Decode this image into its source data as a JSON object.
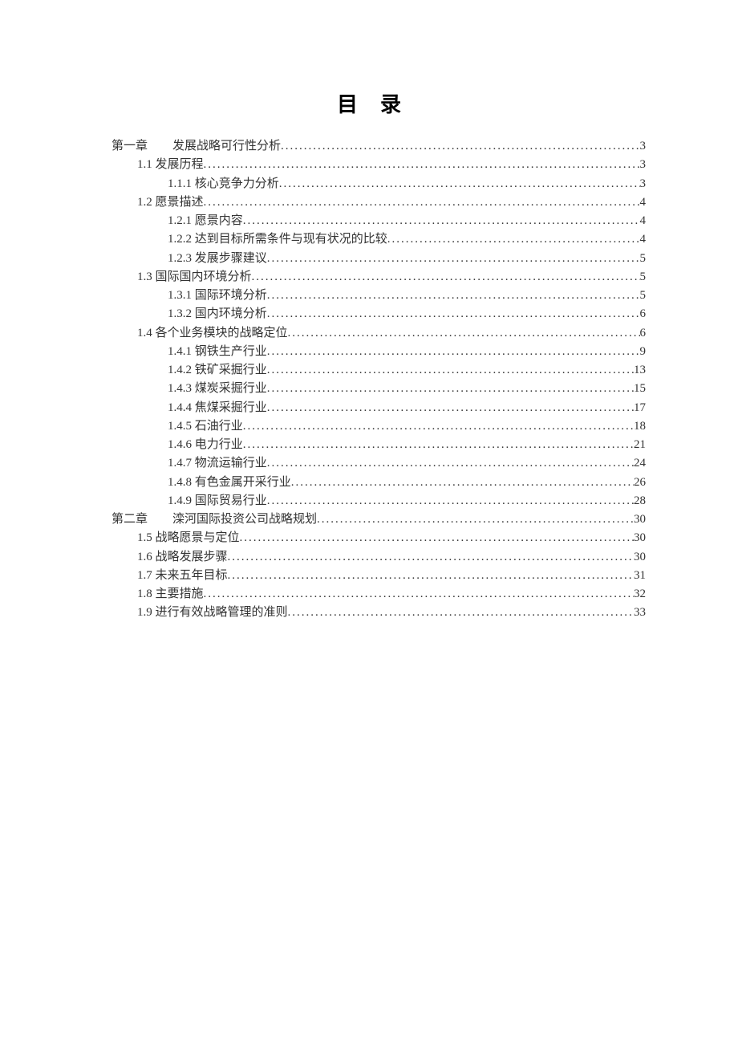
{
  "title": "目录",
  "toc": [
    {
      "level": "chapter",
      "num": "第一章",
      "label": "发展战略可行性分析",
      "page": "3"
    },
    {
      "level": "section",
      "num": "1.1",
      "label": "发展历程",
      "page": "3"
    },
    {
      "level": "sub",
      "num": "1.1.1",
      "label": "核心竞争力分析",
      "page": "3"
    },
    {
      "level": "section",
      "num": "1.2",
      "label": "愿景描述",
      "page": "4"
    },
    {
      "level": "sub",
      "num": "1.2.1",
      "label": "愿景内容",
      "page": "4"
    },
    {
      "level": "sub",
      "num": "1.2.2",
      "label": "达到目标所需条件与现有状况的比较",
      "page": "4"
    },
    {
      "level": "sub",
      "num": "1.2.3",
      "label": "发展步骤建议",
      "page": "5"
    },
    {
      "level": "section",
      "num": "1.3",
      "label": "国际国内环境分析",
      "page": "5"
    },
    {
      "level": "sub",
      "num": "1.3.1",
      "label": "国际环境分析",
      "page": "5"
    },
    {
      "level": "sub",
      "num": "1.3.2",
      "label": "国内环境分析",
      "page": "6"
    },
    {
      "level": "section",
      "num": "1.4",
      "label": "各个业务模块的战略定位",
      "page": "6"
    },
    {
      "level": "sub",
      "num": "1.4.1",
      "label": "钢铁生产行业",
      "page": "9"
    },
    {
      "level": "sub",
      "num": "1.4.2",
      "label": "铁矿采掘行业",
      "page": "13"
    },
    {
      "level": "sub",
      "num": "1.4.3",
      "label": "煤炭采掘行业",
      "page": "15"
    },
    {
      "level": "sub",
      "num": "1.4.4",
      "label": "焦煤采掘行业",
      "page": "17"
    },
    {
      "level": "sub",
      "num": "1.4.5",
      "label": "石油行业",
      "page": "18"
    },
    {
      "level": "sub",
      "num": "1.4.6",
      "label": "电力行业",
      "page": "21"
    },
    {
      "level": "sub",
      "num": "1.4.7",
      "label": "物流运输行业",
      "page": "24"
    },
    {
      "level": "sub",
      "num": "1.4.8",
      "label": "有色金属开采行业",
      "page": "26"
    },
    {
      "level": "sub",
      "num": "1.4.9",
      "label": "国际贸易行业",
      "page": "28"
    },
    {
      "level": "chapter",
      "num": "第二章",
      "label": "滦河国际投资公司战略规划",
      "page": "30"
    },
    {
      "level": "section",
      "num": "1.5",
      "label": "战略愿景与定位",
      "page": "30"
    },
    {
      "level": "section",
      "num": "1.6",
      "label": "战略发展步骤",
      "page": "30"
    },
    {
      "level": "section",
      "num": "1.7",
      "label": "未来五年目标",
      "page": "31"
    },
    {
      "level": "section",
      "num": "1.8",
      "label": "主要措施",
      "page": "32"
    },
    {
      "level": "section",
      "num": "1.9",
      "label": "进行有效战略管理的准则",
      "page": "33"
    }
  ]
}
